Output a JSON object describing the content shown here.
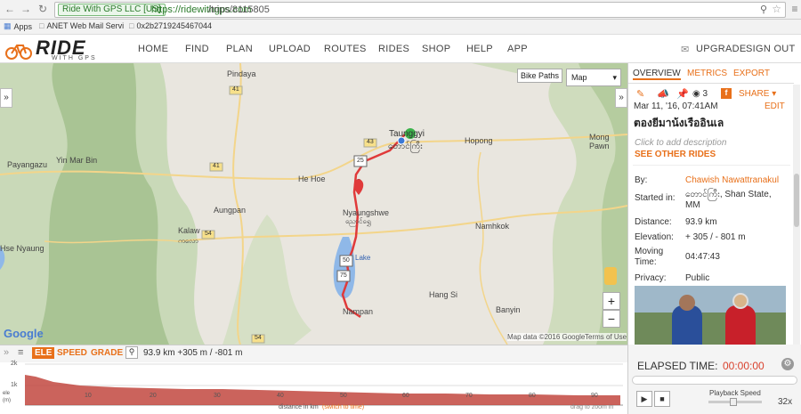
{
  "browser": {
    "secure_label": "Ride With GPS LLC [US]",
    "url_host": "https://ridewithgps.com",
    "url_path": "/trips/8115805",
    "bookmarks": [
      "Apps",
      "ANET Web Mail Servi",
      "0x2b2719245467044"
    ]
  },
  "site": {
    "logo_text": "RIDE",
    "logo_sub": "WITH GPS",
    "nav": [
      "HOME",
      "FIND",
      "PLAN",
      "UPLOAD",
      "ROUTES",
      "RIDES",
      "SHOP",
      "HELP",
      "APP"
    ],
    "upgrade": "UPGRADE",
    "signout": "SIGN OUT"
  },
  "map": {
    "bike_paths": "Bike Paths",
    "map_type": "Map",
    "places": [
      "Pindaya",
      "Taunggyi",
      "တောင်ကြီး",
      "Hopong",
      "Mong Pawn",
      "Payangazu",
      "Yin Mar Bin",
      "He Hoe",
      "Aungpan",
      "Nyaungshwe",
      "ညောင်ရွှေ",
      "Kalaw",
      "ကလော",
      "Namhkok",
      "Hang Si",
      "Nampan",
      "Banyin",
      "Hse Nyaung",
      "Lake"
    ],
    "roads": [
      "41",
      "41",
      "43",
      "25",
      "54",
      "50",
      "75",
      "54"
    ],
    "attribution": "Map data ©2016 Google",
    "terms": "Terms of Use",
    "google": "Google",
    "zoom_in": "+",
    "zoom_out": "−"
  },
  "panel": {
    "tabs": [
      "OVERVIEW",
      "METRICS",
      "EXPORT"
    ],
    "views": "3",
    "share": "SHARE",
    "date": "Mar 11, '16, 07:41AM",
    "edit": "EDIT",
    "title": "ตองยีมาน้งเรืออินเล",
    "add_desc": "Click to add description",
    "see_other": "SEE OTHER RIDES",
    "by_label": "By:",
    "by_value": "Chawish Nawattranakul",
    "started_label": "Started in:",
    "started_value": "တောင်ကြီး, Shan State, MM",
    "distance_label": "Distance:",
    "distance_value": "93.9 km",
    "elevation_label": "Elevation:",
    "elevation_value": "+ 305 / - 801 m",
    "moving_label": "Moving Time:",
    "moving_value": "04:47:43",
    "privacy_label": "Privacy:",
    "privacy_value": "Public"
  },
  "elevation": {
    "tabs": [
      "ELE",
      "SPEED",
      "GRADE"
    ],
    "summary": "93.9 km +305 m / -801 m",
    "y_ticks": [
      "2k",
      "1k"
    ],
    "y_label": "ele (m)",
    "x_ticks": [
      "10",
      "20",
      "30",
      "40",
      "50",
      "60",
      "70",
      "80",
      "90"
    ],
    "x_label": "distance in km",
    "switch": "(switch to time)",
    "drag_hint": "drag to zoom in"
  },
  "playback": {
    "elapsed_label": "ELAPSED TIME:",
    "elapsed_value": "00:00:00",
    "speed_label": "Playback Speed",
    "speed_value": "32x"
  },
  "colors": {
    "accent": "#e8701a",
    "route": "#e03a3a",
    "ele_fill": "#c2483f"
  }
}
